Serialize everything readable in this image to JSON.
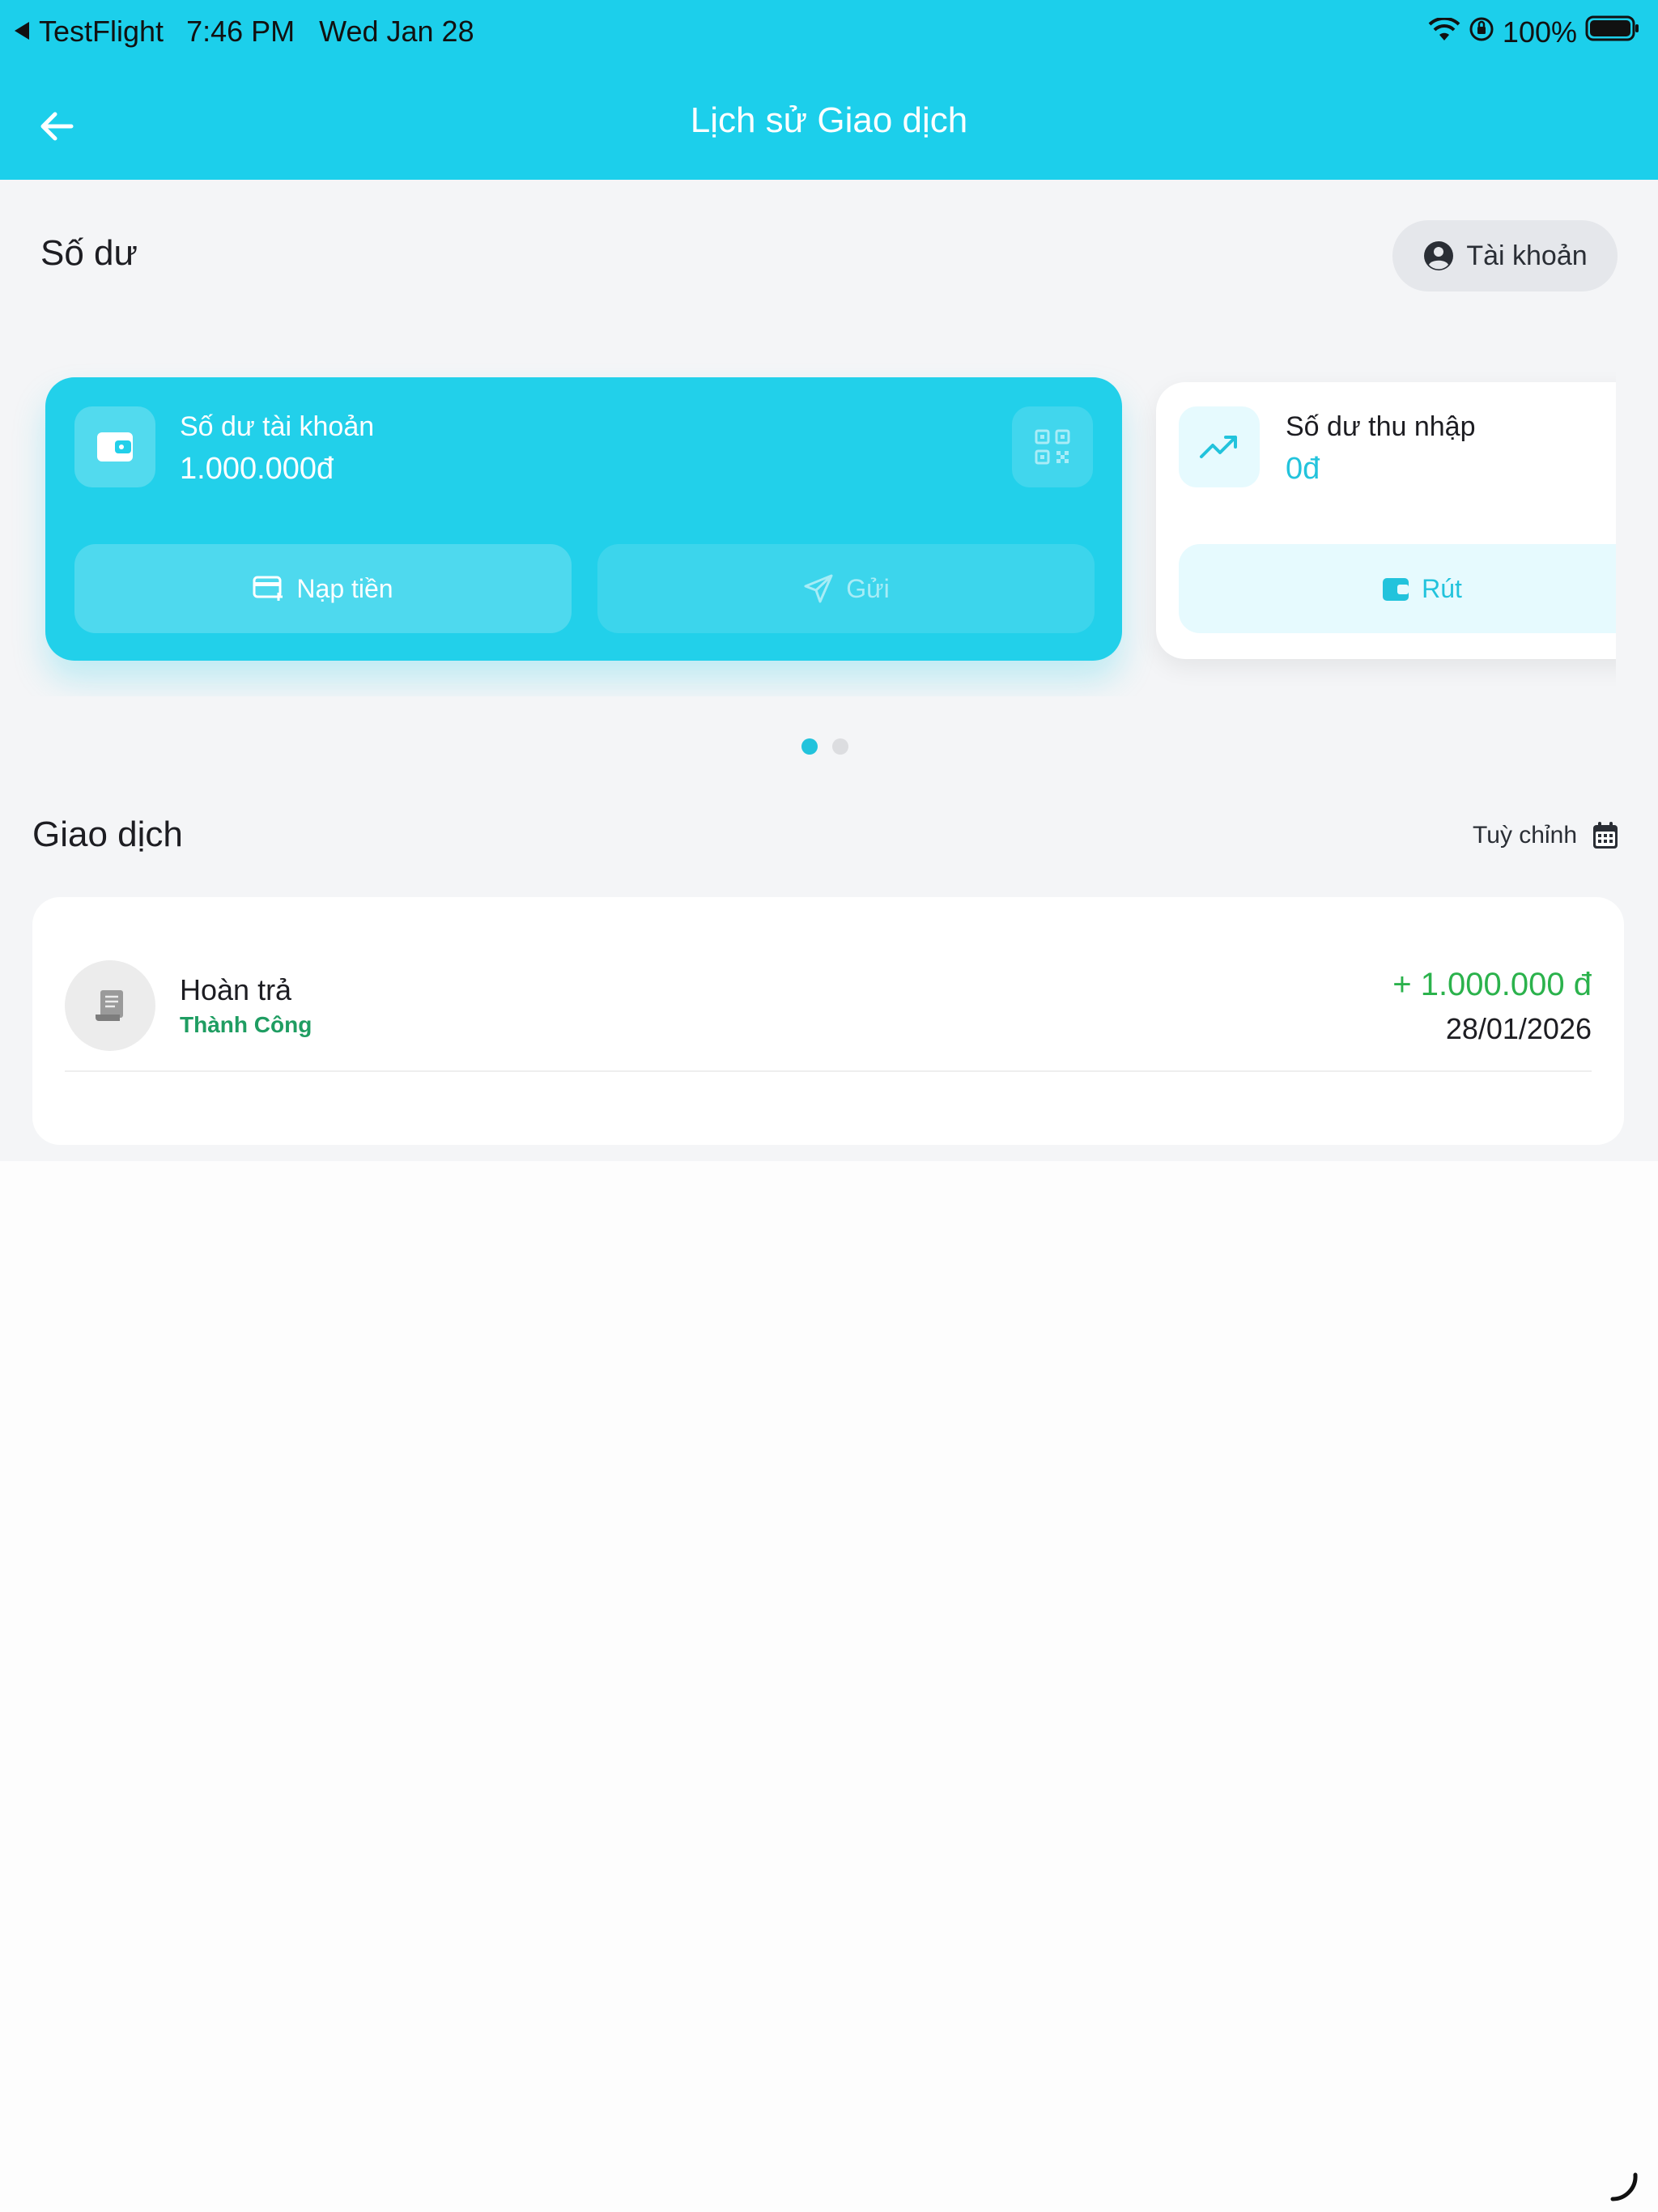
{
  "status_bar": {
    "back_app": "TestFlight",
    "time": "7:46 PM",
    "date": "Wed Jan 28",
    "battery": "100%"
  },
  "header": {
    "title": "Lịch sử Giao dịch"
  },
  "balance_section": {
    "title": "Số dư",
    "account_button": "Tài khoản"
  },
  "cards": [
    {
      "label": "Số dư tài khoản",
      "amount": "1.000.000đ",
      "buttons": [
        "Nạp tiền",
        "Gửi"
      ]
    },
    {
      "label": "Số dư thu nhập",
      "amount": "0đ",
      "buttons": [
        "Rút"
      ]
    }
  ],
  "carousel": {
    "pages": 2,
    "active": 0
  },
  "transactions_section": {
    "title": "Giao dịch",
    "filter_label": "Tuỳ chỉnh"
  },
  "transactions": [
    {
      "name": "Hoàn trả",
      "status": "Thành Công",
      "amount": "+ 1.000.000 đ",
      "date": "28/01/2026"
    }
  ],
  "colors": {
    "primary": "#1ccfeb",
    "card_primary": "#22d0ea",
    "success_text": "#1f9d62",
    "amount_positive": "#2bb24c",
    "background": "#f4f5f7"
  }
}
